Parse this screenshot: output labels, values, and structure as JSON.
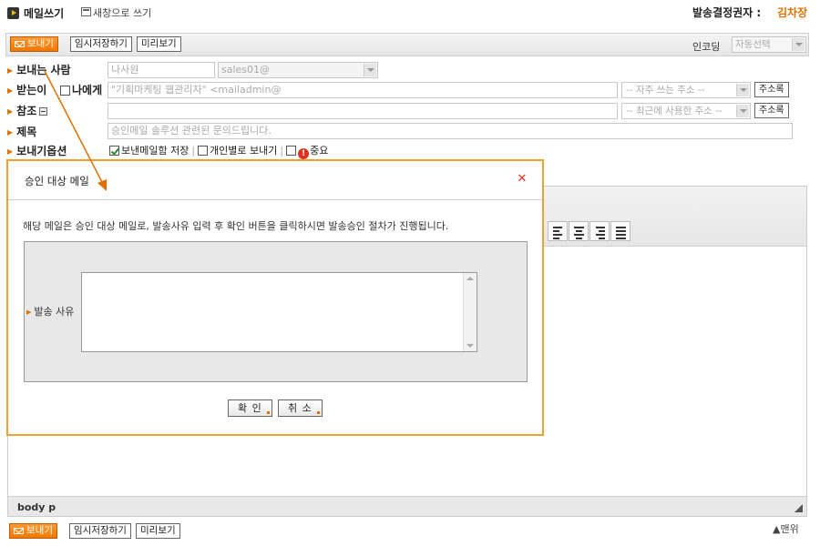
{
  "header": {
    "title": "메일쓰기",
    "new_window": "새창으로 쓰기",
    "approver_label": "발송결정권자 :",
    "approver_name": "김차장"
  },
  "toolbar": {
    "send": "보내기",
    "save_draft": "임시저장하기",
    "preview": "미리보기",
    "encoding_label": "인코딩",
    "encoding_value": "자동선택"
  },
  "form": {
    "sender_label": "보내는 사람",
    "sender_name": "나사원",
    "sender_email": "sales01@",
    "to_label": "받는이",
    "to_self": "나에게",
    "to_value": "\"기획마케팅 웹관리자\" <mailadmin@",
    "to_addr_select": "-- 자주 쓰는 주소 --",
    "cc_label": "참조",
    "cc_addr_select": "-- 최근에 사용한 주소 --",
    "address_book": "주소록",
    "subject_label": "제목",
    "subject_value": "승인메일 솔루션 관련된 문의드립니다.",
    "options_label": "보내기옵션",
    "opt_save_sent": "보낸메일함 저장",
    "opt_individual": "개인별로 보내기",
    "opt_important": "중요",
    "important_glyph": "!"
  },
  "editor": {
    "status_path": "body  p"
  },
  "footer": {
    "top_link": "▲맨위"
  },
  "modal": {
    "title": "승인 대상 메일",
    "close_glyph": "✕",
    "message": "해당 메일은 승인 대상 메일로, 발송사유 입력 후 확인 버튼을 클릭하시면 발송승인 절차가 진행됩니다.",
    "reason_label": "발송 사유",
    "confirm": "확 인",
    "cancel": "취 소"
  },
  "colors": {
    "accent": "#f07800",
    "modal_border": "#f0a030",
    "arrow": "#e07000"
  }
}
